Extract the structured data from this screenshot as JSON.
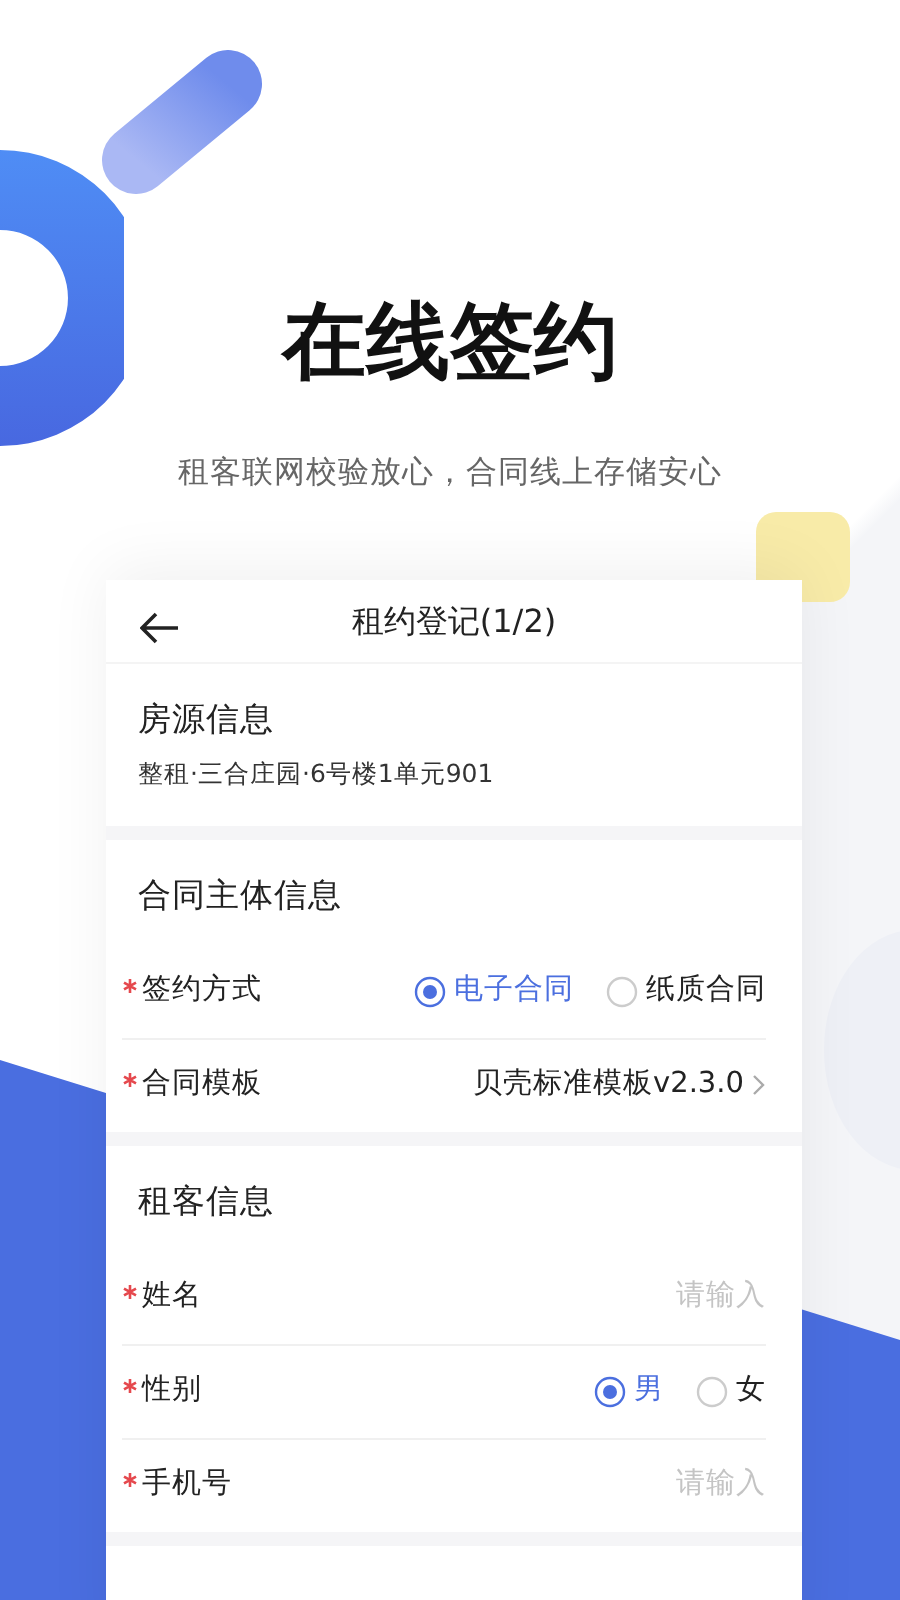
{
  "headline": "在线签约",
  "subtitle": "租客联网校验放心，合同线上存储安心",
  "screen": {
    "title": "租约登记(1/2)",
    "sections": [
      {
        "title": "房源信息",
        "detail": "整租·三合庄园·6号楼1单元901"
      },
      {
        "title": "合同主体信息",
        "fields": [
          {
            "kind": "radio",
            "label": "签约方式",
            "required": true,
            "options": [
              {
                "label": "电子合同",
                "selected": true
              },
              {
                "label": "纸质合同",
                "selected": false
              }
            ]
          },
          {
            "kind": "select",
            "label": "合同模板",
            "required": true,
            "value": "贝壳标准模板v2.3.0"
          }
        ]
      },
      {
        "title": "租客信息",
        "fields": [
          {
            "kind": "input",
            "label": "姓名",
            "required": true,
            "placeholder": "请输入"
          },
          {
            "kind": "radio",
            "label": "性别",
            "required": true,
            "options": [
              {
                "label": "男",
                "selected": true
              },
              {
                "label": "女",
                "selected": false
              }
            ]
          },
          {
            "kind": "input",
            "label": "手机号",
            "required": true,
            "placeholder": "请输入"
          }
        ]
      }
    ]
  }
}
